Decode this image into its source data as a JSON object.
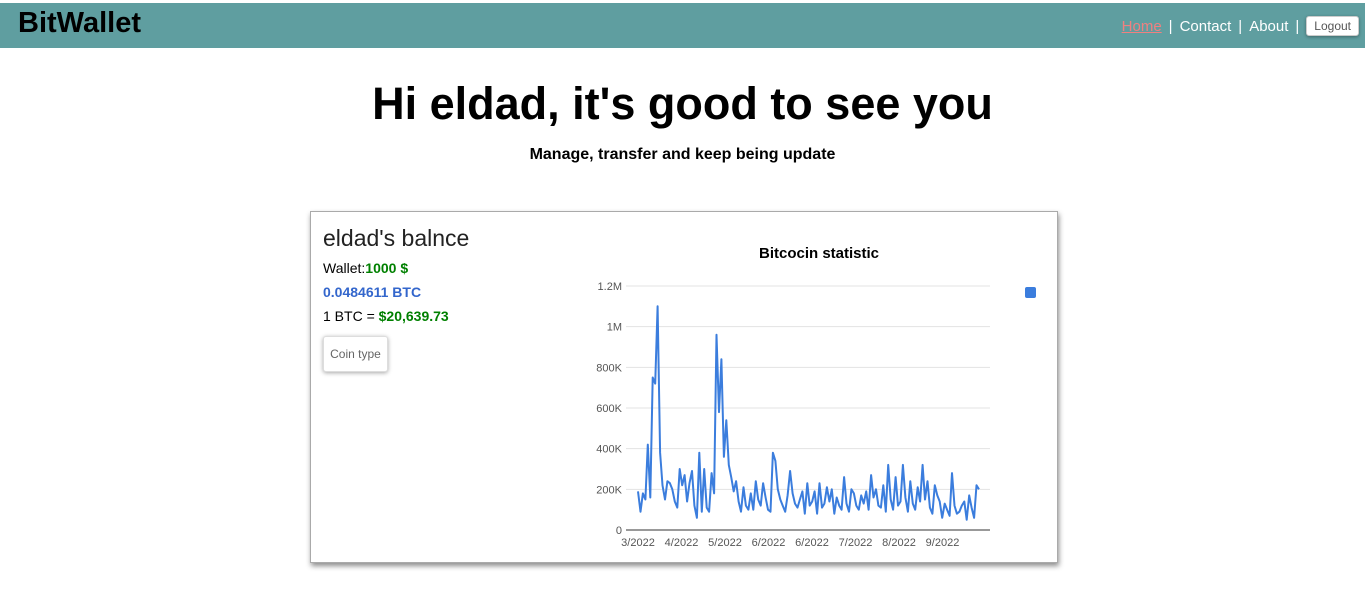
{
  "header": {
    "brand": "BitWallet",
    "nav": {
      "home": "Home",
      "contact": "Contact",
      "about": "About",
      "separator": "|"
    },
    "logout_label": "Logout",
    "bg_color": "#5f9ea0"
  },
  "hero": {
    "greeting": "Hi eldad, it's good to see you",
    "subtitle": "Manage, transfer and keep being update"
  },
  "balance": {
    "title": "eldad's balnce",
    "wallet_label": "Wallet:",
    "wallet_value": "1000 $",
    "btc_value": "0.0484611 BTC",
    "rate_label": "1 BTC = ",
    "rate_value": "$20,639.73",
    "coin_type_label": "Coin type"
  },
  "chart_data": {
    "type": "line",
    "title": "Bitcocin statistic",
    "x_ticks": [
      "3/2022",
      "4/2022",
      "5/2022",
      "6/2022",
      "6/2022",
      "7/2022",
      "8/2022",
      "9/2022"
    ],
    "y_ticks": [
      "0",
      "200K",
      "400K",
      "600K",
      "800K",
      "1M",
      "1.2M"
    ],
    "ylim": [
      0,
      1200000
    ],
    "grid": true,
    "legend": "right",
    "series": [
      {
        "color": "#3b7ddd",
        "values": [
          190000,
          90000,
          180000,
          150000,
          420000,
          160000,
          750000,
          720000,
          1100000,
          380000,
          220000,
          150000,
          240000,
          230000,
          200000,
          140000,
          110000,
          300000,
          220000,
          270000,
          140000,
          230000,
          290000,
          120000,
          60000,
          380000,
          90000,
          300000,
          110000,
          90000,
          280000,
          180000,
          960000,
          580000,
          840000,
          360000,
          540000,
          320000,
          260000,
          190000,
          240000,
          140000,
          90000,
          210000,
          120000,
          100000,
          180000,
          100000,
          240000,
          150000,
          120000,
          230000,
          160000,
          100000,
          90000,
          380000,
          340000,
          200000,
          150000,
          120000,
          90000,
          170000,
          290000,
          180000,
          130000,
          110000,
          150000,
          190000,
          80000,
          230000,
          120000,
          140000,
          190000,
          80000,
          230000,
          110000,
          130000,
          210000,
          140000,
          200000,
          80000,
          160000,
          120000,
          100000,
          260000,
          130000,
          90000,
          200000,
          180000,
          120000,
          100000,
          170000,
          130000,
          190000,
          100000,
          270000,
          160000,
          200000,
          120000,
          110000,
          220000,
          90000,
          320000,
          150000,
          100000,
          260000,
          120000,
          140000,
          320000,
          160000,
          90000,
          240000,
          130000,
          100000,
          210000,
          140000,
          320000,
          150000,
          240000,
          110000,
          80000,
          220000,
          170000,
          140000,
          60000,
          130000,
          100000,
          70000,
          280000,
          120000,
          80000,
          90000,
          120000,
          140000,
          50000,
          170000,
          110000,
          60000,
          220000,
          200000
        ]
      }
    ]
  }
}
